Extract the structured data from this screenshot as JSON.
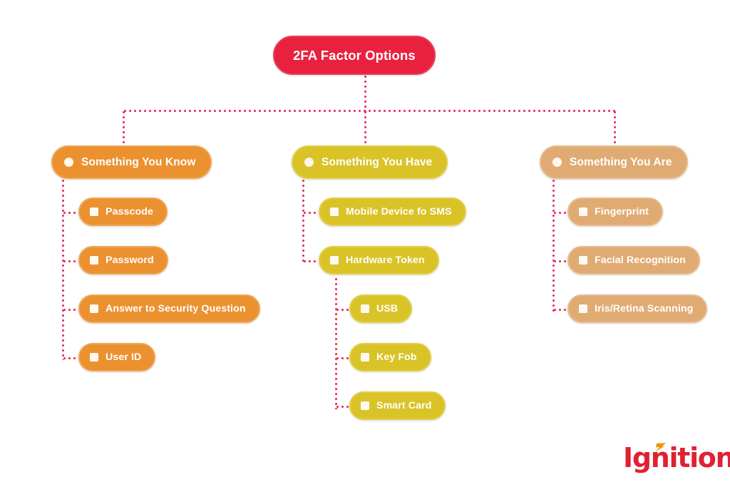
{
  "diagram": {
    "title": "2FA Factor Options",
    "type": "tree",
    "background_color": "#ffffff",
    "connector_color": "#ed2556",
    "connector_style": "dotted",
    "root": {
      "label": "2FA Factor Options",
      "color": "#e8213f"
    },
    "branches": [
      {
        "label": "Something You Know",
        "color": "#ec912f",
        "bullet": "circle-bullet",
        "children": [
          {
            "label": "Passcode",
            "bullet": "square-bullet"
          },
          {
            "label": "Password",
            "bullet": "square-bullet"
          },
          {
            "label": "Answer to Security Question",
            "bullet": "square-bullet"
          },
          {
            "label": "User ID",
            "bullet": "square-bullet"
          }
        ]
      },
      {
        "label": "Something You Have",
        "color": "#d9c327",
        "bullet": "circle-bullet",
        "children": [
          {
            "label": "Mobile Device fo SMS",
            "bullet": "square-bullet"
          },
          {
            "label": "Hardware Token",
            "bullet": "square-bullet",
            "children": [
              {
                "label": "USB",
                "bullet": "square-bullet"
              },
              {
                "label": "Key Fob",
                "bullet": "square-bullet"
              },
              {
                "label": "Smart Card",
                "bullet": "square-bullet"
              }
            ]
          }
        ]
      },
      {
        "label": "Something You Are",
        "color": "#e0ab73",
        "bullet": "circle-bullet",
        "children": [
          {
            "label": "Fingerprint",
            "bullet": "square-bullet"
          },
          {
            "label": "Facial Recognition",
            "bullet": "square-bullet"
          },
          {
            "label": "Iris/Retina Scanning",
            "bullet": "square-bullet"
          }
        ]
      }
    ]
  },
  "logo": {
    "text": "Ignition",
    "accent_icon": "lightning-bolt-icon",
    "text_color": "#e02132",
    "accent_color": "#f39200"
  }
}
